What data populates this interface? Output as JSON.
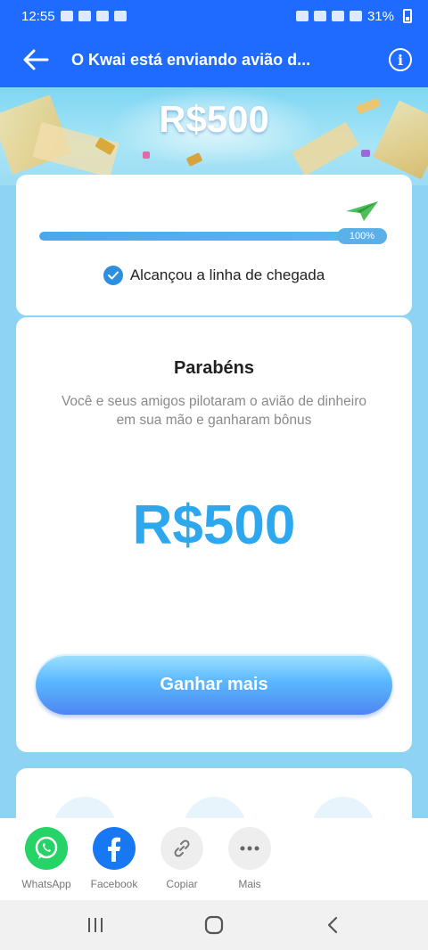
{
  "status_bar": {
    "time": "12:55",
    "battery": "31%"
  },
  "app_bar": {
    "title": "O Kwai está enviando avião d..."
  },
  "hero": {
    "amount": "R$500"
  },
  "progress": {
    "percent_label": "100%",
    "value": 1.0,
    "finish_text": "Alcançou a linha de chegada"
  },
  "reward": {
    "title": "Parabéns",
    "description": "Você e seus amigos pilotaram o avião de dinheiro em sua mão e ganharam bônus",
    "amount": "R$500",
    "button_label": "Ganhar mais"
  },
  "share": {
    "items": [
      {
        "label": "WhatsApp",
        "icon": "whatsapp-icon"
      },
      {
        "label": "Facebook",
        "icon": "facebook-icon"
      },
      {
        "label": "Copiar",
        "icon": "link-icon"
      },
      {
        "label": "Mais",
        "icon": "more-icon"
      }
    ]
  },
  "colors": {
    "app_bar": "#1f6bff",
    "accent": "#2da8ee",
    "whatsapp": "#25d366",
    "facebook": "#1877f2"
  }
}
